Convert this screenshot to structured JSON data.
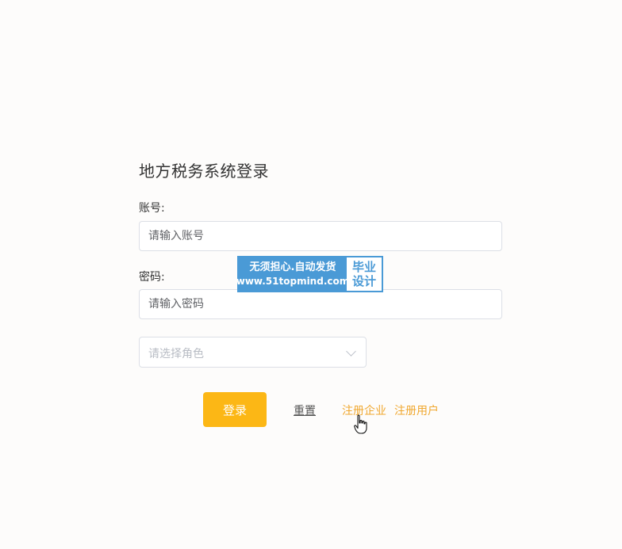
{
  "form": {
    "title": "地方税务系统登录",
    "account_label": "账号:",
    "account_placeholder": "请输入账号",
    "password_label": "密码:",
    "password_placeholder": "请输入密码",
    "role_placeholder": "请选择角色",
    "login_label": "登录",
    "reset_label": "重置",
    "register_company_label": "注册企业",
    "register_user_label": "注册用户"
  },
  "watermark": {
    "line1": "无须担心.自动发货",
    "line2": "www.51topmind.com",
    "right_top": "毕业",
    "right_bottom": "设计"
  },
  "colors": {
    "accent": "#fcb715",
    "link": "#f0a830",
    "watermark_blue": "#4a9ad6"
  },
  "icons": {
    "select_arrow": "chevron-down-icon",
    "pointer": "hand-pointer-icon"
  }
}
